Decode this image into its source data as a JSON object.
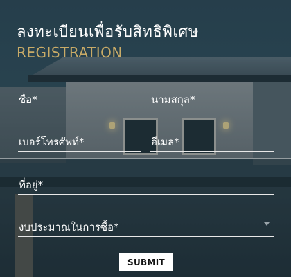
{
  "header": {
    "title_th": "ลงทะเบียนเพื่อรับสิทธิพิเศษ",
    "title_en": "REGISTRATION"
  },
  "form": {
    "first_name_label": "ชื่อ*",
    "last_name_label": "นามสกุล*",
    "phone_label": "เบอร์โทรศัพท์*",
    "email_label": "อีเมล*",
    "address_label": "ที่อยู่*",
    "budget_label": "งบประมาณในการซื้อ*",
    "submit_label": "SUBMIT"
  },
  "colors": {
    "accent": "#c9ab67",
    "field_line": "#e8e8e8",
    "button_bg": "#ffffff"
  },
  "icons": {
    "budget_dropdown": "chevron-down-icon"
  }
}
